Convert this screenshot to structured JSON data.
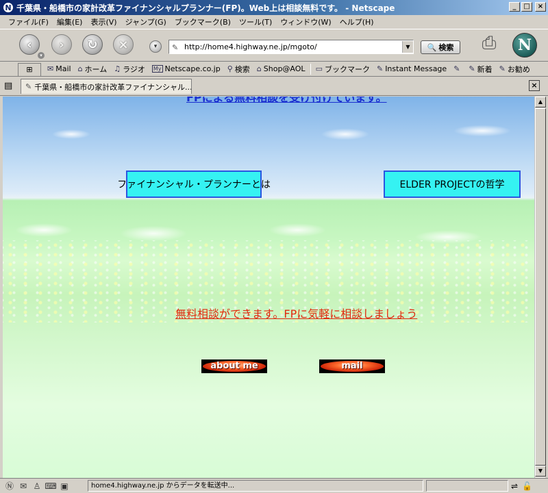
{
  "window": {
    "title": "千葉県・船橋市の家計改革ファイナンシャルプランナー(FP)。Web上は相談無料です。 - Netscape",
    "icon_letter": "N"
  },
  "menu": [
    "ファイル(F)",
    "編集(E)",
    "表示(V)",
    "ジャンプ(G)",
    "ブックマーク(B)",
    "ツール(T)",
    "ウィンドウ(W)",
    "ヘルプ(H)"
  ],
  "navigation": {
    "url": "http://home4.highway.ne.jp/mgoto/",
    "search_label": "検索",
    "logo_letter": "N"
  },
  "personal_toolbar": {
    "items": [
      {
        "icon": "mail-icon",
        "label": "Mail"
      },
      {
        "icon": "home-icon",
        "label": "ホーム"
      },
      {
        "icon": "radio-icon",
        "label": "ラジオ"
      },
      {
        "icon": "my-netscape-icon",
        "label": "Netscape.co.jp"
      },
      {
        "icon": "search-icon",
        "label": "検索"
      },
      {
        "icon": "shop-icon",
        "label": "Shop@AOL"
      },
      {
        "icon": "bookmark-folder-icon",
        "label": "ブックマーク"
      },
      {
        "icon": "bookmark-icon",
        "label": "Instant Message"
      },
      {
        "icon": "bookmark-icon",
        "label": ""
      },
      {
        "icon": "bookmark-icon",
        "label": "新着"
      },
      {
        "icon": "bookmark-icon",
        "label": "お勧め"
      }
    ]
  },
  "tab": {
    "title": "千葉県・船橋市の家計改革ファイナンシャル..."
  },
  "content": {
    "top_link": "FPによる無料相談を受け付けています。",
    "box_buttons": [
      {
        "label": "ファイナンシャル・プランナーとは"
      },
      {
        "label": "ELDER PROJECTの哲学"
      }
    ],
    "consult_link": "無料相談ができます。FPに気軽に相談しましょう",
    "pill_buttons": [
      {
        "label": "about me"
      },
      {
        "label": "mail"
      }
    ]
  },
  "status": {
    "text": "home4.highway.ne.jp からデータを転送中..."
  },
  "colors": {
    "title_bar": "#0a246a",
    "link_blue": "#1a2fd0",
    "link_red": "#e02a10",
    "box_fill": "#35f2f2",
    "box_border": "#2b56e0"
  }
}
